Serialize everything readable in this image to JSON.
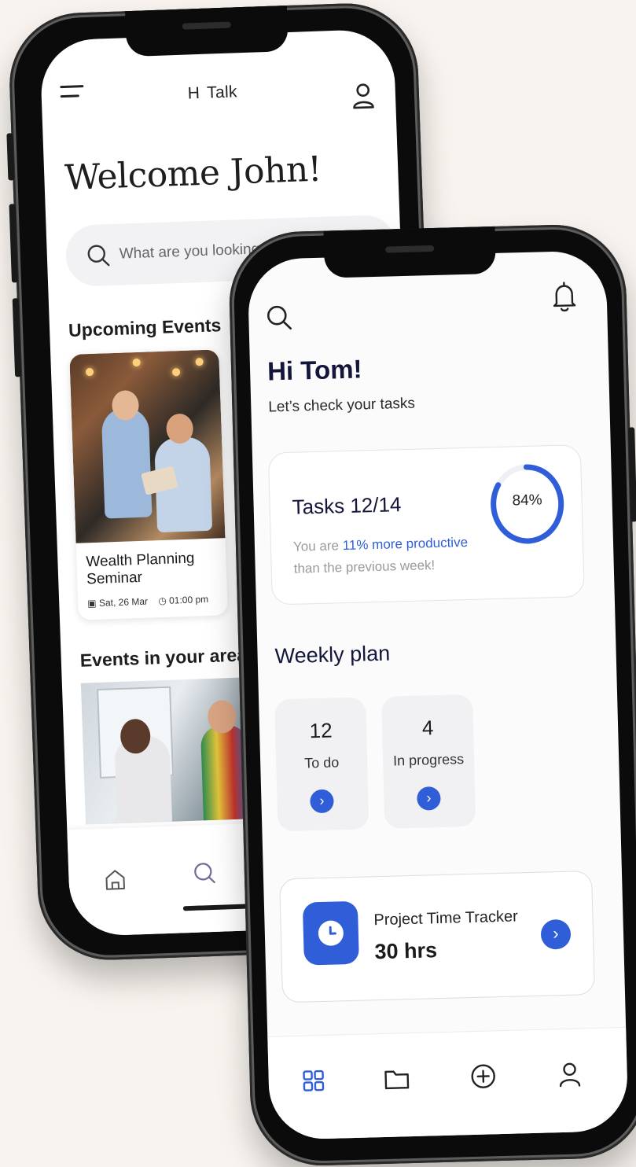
{
  "back_phone": {
    "logo": "H  Talk",
    "welcome": "Welcome John!",
    "search_placeholder": "What are you looking for?",
    "upcoming_title": "Upcoming Events",
    "event": {
      "name": "Wealth Planning Seminar",
      "date": "Sat, 26 Mar",
      "time": "01:00 pm"
    },
    "area_title": "Events in your area"
  },
  "front_phone": {
    "greeting": "Hi Tom!",
    "subtitle": "Let’s check your tasks",
    "tasks": {
      "title": "Tasks 12/14",
      "msg_prefix": "You are ",
      "msg_highlight": "11% more productive",
      "msg_suffix": "than the previous week!",
      "percent_label": "84%",
      "percent": 84
    },
    "weekly_title": "Weekly plan",
    "weekly": [
      {
        "count": "12",
        "label": "To do"
      },
      {
        "count": "4",
        "label": "In progress"
      }
    ],
    "tracker": {
      "title": "Project Time Tracker",
      "value": "30 hrs"
    }
  },
  "colors": {
    "accent": "#2f5ed8",
    "heading": "#13163a",
    "background": "#f8f3ee"
  },
  "icons": {
    "menu": "hamburger-icon",
    "user": "user-icon",
    "search": "search-icon",
    "bell": "bell-icon",
    "home": "home-icon",
    "grid": "grid-icon",
    "folder": "folder-icon",
    "plus": "plus-circle-icon",
    "chevron": "chevron-right-icon",
    "clock": "clock-icon"
  }
}
